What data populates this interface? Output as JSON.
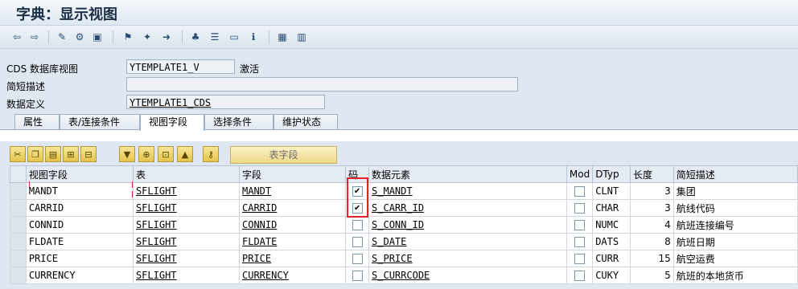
{
  "title": "字典：显示视图",
  "toolbar": {
    "icons": [
      "back-icon",
      "forward-icon",
      "other-object-icon",
      "display-change-icon",
      "check-icon",
      "activate-icon",
      "where-used-icon",
      "navigate-icon",
      "hierarchy-icon",
      "object-list-icon",
      "display-navigation-icon",
      "info-icon",
      "layout-icon",
      "table-icon"
    ]
  },
  "fields": {
    "cds_view_label": "CDS 数据库视图",
    "cds_view_value": "YTEMPLATE1_V",
    "cds_view_status": "激活",
    "short_desc_label": "简短描述",
    "short_desc_value": "",
    "data_def_label": "数据定义",
    "data_def_value": "YTEMPLATE1_CDS"
  },
  "tabs": [
    "属性",
    "表/连接条件",
    "视图字段",
    "选择条件",
    "维护状态"
  ],
  "active_tab": "视图字段",
  "table_toolbar": {
    "icons": [
      "cut-icon",
      "copy-icon",
      "paste-icon",
      "insert-row-icon",
      "delete-row-icon",
      "sort-icon",
      "expand-icon",
      "select-icon",
      "collapse-icon",
      "key-icon"
    ],
    "table_fields_label": "表字段"
  },
  "grid": {
    "headers": [
      "视图字段",
      "表",
      "字段",
      "码",
      "数据元素",
      "Mod",
      "DTyp",
      "长度",
      "简短描述"
    ],
    "rows": [
      {
        "view_field": "MANDT",
        "table": "SFLIGHT",
        "field": "MANDT",
        "key": true,
        "data_element": "S_MANDT",
        "mod": false,
        "dtyp": "CLNT",
        "length": "3",
        "desc": "集团"
      },
      {
        "view_field": "CARRID",
        "table": "SFLIGHT",
        "field": "CARRID",
        "key": true,
        "data_element": "S_CARR_ID",
        "mod": false,
        "dtyp": "CHAR",
        "length": "3",
        "desc": "航线代码"
      },
      {
        "view_field": "CONNID",
        "table": "SFLIGHT",
        "field": "CONNID",
        "key": false,
        "data_element": "S_CONN_ID",
        "mod": false,
        "dtyp": "NUMC",
        "length": "4",
        "desc": "航班连接编号"
      },
      {
        "view_field": "FLDATE",
        "table": "SFLIGHT",
        "field": "FLDATE",
        "key": false,
        "data_element": "S_DATE",
        "mod": false,
        "dtyp": "DATS",
        "length": "8",
        "desc": "航班日期"
      },
      {
        "view_field": "PRICE",
        "table": "SFLIGHT",
        "field": "PRICE",
        "key": false,
        "data_element": "S_PRICE",
        "mod": false,
        "dtyp": "CURR",
        "length": "15",
        "desc": "航空运费"
      },
      {
        "view_field": "CURRENCY",
        "table": "SFLIGHT",
        "field": "CURRENCY",
        "key": false,
        "data_element": "S_CURRCODE",
        "mod": false,
        "dtyp": "CUKY",
        "length": "5",
        "desc": "航班的本地货币"
      }
    ]
  },
  "colors": {
    "highlight": "#e0242a",
    "background": "#dfe8f1"
  }
}
